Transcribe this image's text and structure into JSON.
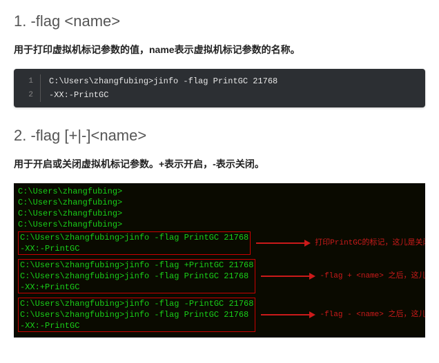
{
  "section1": {
    "heading": "1. -flag <name>",
    "desc": "用于打印虚拟机标记参数的值，name表示虚拟机标记参数的名称。",
    "code": {
      "lines": [
        {
          "no": "1",
          "text": "C:\\Users\\zhangfubing>jinfo -flag PrintGC 21768"
        },
        {
          "no": "2",
          "text": "-XX:-PrintGC"
        }
      ]
    }
  },
  "section2": {
    "heading": "2. -flag [+|-]<name>",
    "desc": "用于开启或关闭虚拟机标记参数。+表示开启，-表示关闭。",
    "terminal": {
      "prelines": [
        "C:\\Users\\zhangfubing>",
        "C:\\Users\\zhangfubing>",
        "C:\\Users\\zhangfubing>",
        "C:\\Users\\zhangfubing>"
      ],
      "box1": {
        "l1": "C:\\Users\\zhangfubing>jinfo -flag PrintGC 21768",
        "l2": "-XX:-PrintGC"
      },
      "annot1": "打印PrintGC的标记，这儿是关闭状态",
      "box2": {
        "l1": "C:\\Users\\zhangfubing>jinfo -flag +PrintGC 21768",
        "gap": "",
        "l2": "C:\\Users\\zhangfubing>jinfo -flag PrintGC 21768",
        "l3": "-XX:+PrintGC"
      },
      "annot2": "-flag + <name> 之后，这儿就变成开启状态了",
      "box3": {
        "l1": "C:\\Users\\zhangfubing>jinfo -flag -PrintGC 21768",
        "gap": "",
        "l2": "C:\\Users\\zhangfubing>jinfo -flag PrintGC 21768",
        "l3": "-XX:-PrintGC"
      },
      "annot3": "-flag - <name> 之后，这儿再次变成关闭状态了"
    }
  }
}
